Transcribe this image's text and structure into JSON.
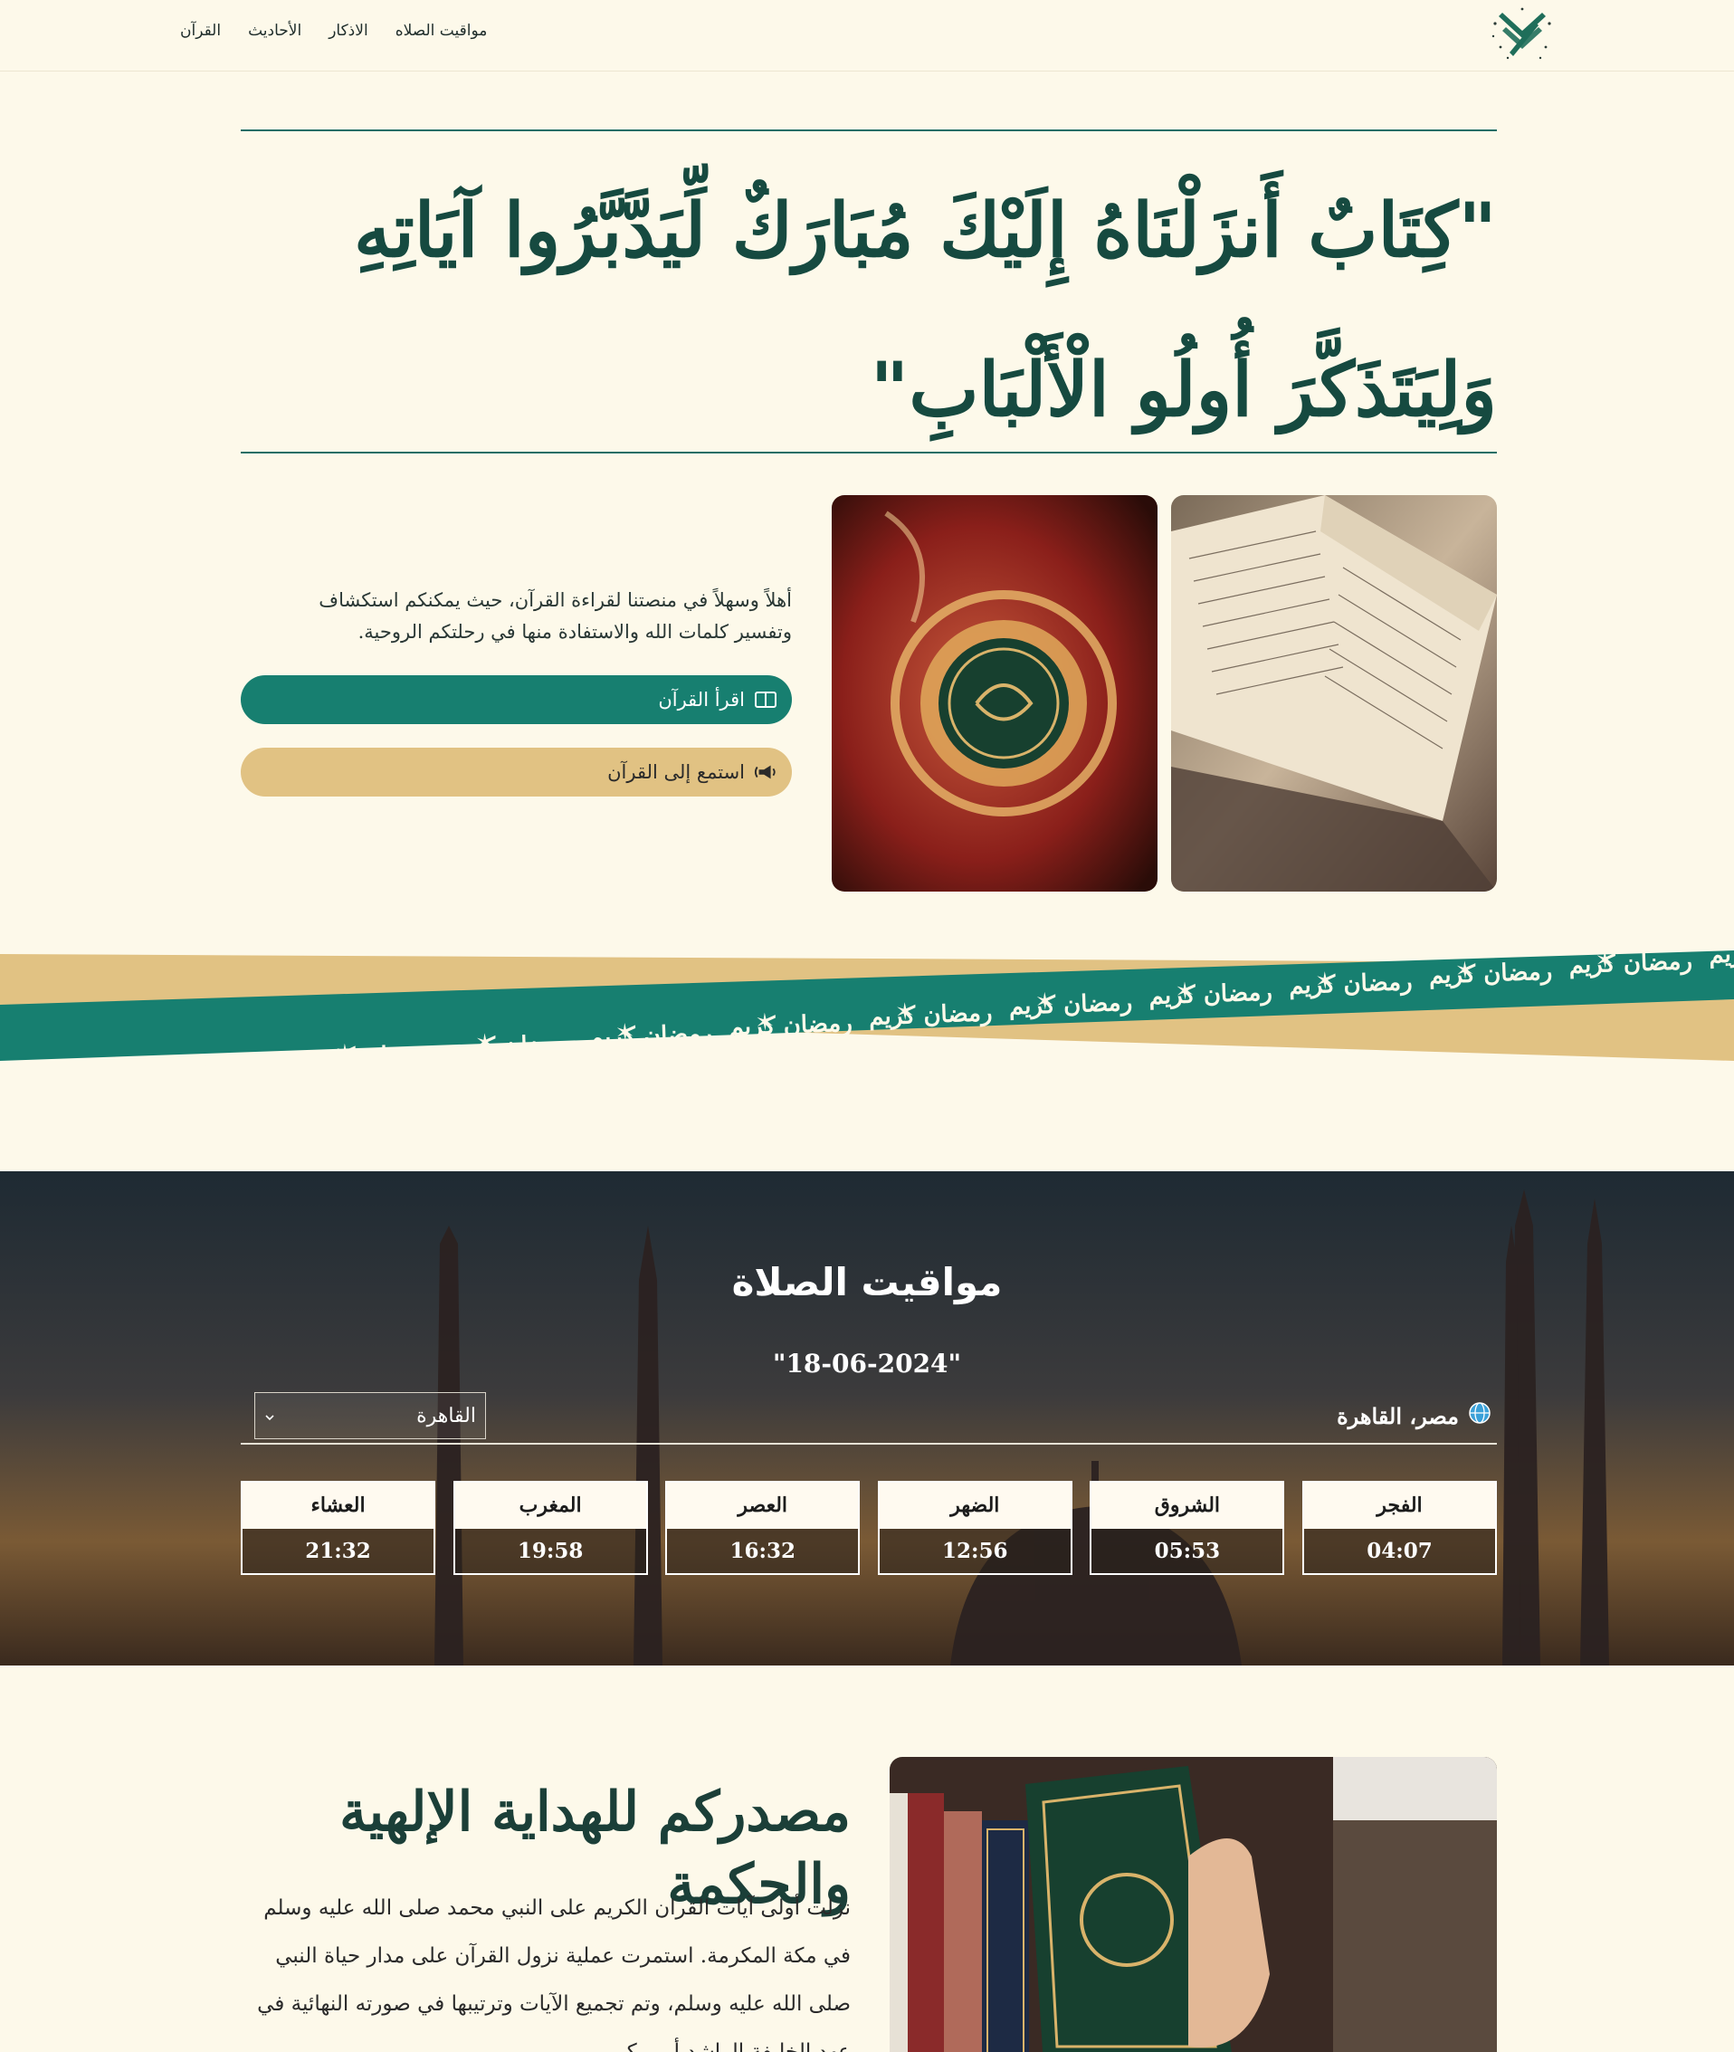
{
  "nav": {
    "links": [
      "القرآن",
      "الأحاديث",
      "الاذكار",
      "مواقيت الصلاه"
    ]
  },
  "hero": {
    "verse": "\"كِتَابٌ أَنزَلْنَاهُ إِلَيْكَ مُبَارَكٌ لِّيَدَّبَّرُوا آيَاتِهِ وَلِيَتَذَكَّرَ أُولُو الْأَلْبَابِ\""
  },
  "intro": {
    "text": "أهلاً وسهلاً في منصتنا لقراءة القرآن، حيث يمكنكم استكشاف وتفسير كلمات الله والاستفادة منها في رحلتكم الروحية.",
    "read_button": "اقرأ القرآن",
    "listen_button": "استمع إلى القرآن"
  },
  "banner": {
    "phrase": "رمضان كريم"
  },
  "prayer": {
    "title": "مواقيت الصلاة",
    "date": "\"18-06-2024\"",
    "location": "مصر، القاهرة",
    "selected_city": "القاهرة",
    "times": [
      {
        "name": "الفجر",
        "time": "04:07"
      },
      {
        "name": "الشروق",
        "time": "05:53"
      },
      {
        "name": "الضهر",
        "time": "12:56"
      },
      {
        "name": "العصر",
        "time": "16:32"
      },
      {
        "name": "المغرب",
        "time": "19:58"
      },
      {
        "name": "العشاء",
        "time": "21:32"
      }
    ]
  },
  "guidance": {
    "title": "مصدركم للهداية الإلهية والحكمة",
    "text": "نزلت أولى آيات القران الكريم على النبي محمد صلى الله عليه وسلم في مكة المكرمة. استمرت عملية نزول القرآن على مدار حياة النبي صلى الله عليه وسلم، وتم تجميع الآيات وترتيبها في صورته النهائية في عهد الخليفة الراشد أبي بكر"
  },
  "colors": {
    "background": "#fdf9ea",
    "primary": "#177f70",
    "gold": "#e1c283",
    "dark_text": "#163b36"
  },
  "icons": [
    "logo-icon",
    "book-icon",
    "speaker-icon",
    "globe-icon",
    "chevron-down-icon",
    "star-icon"
  ]
}
